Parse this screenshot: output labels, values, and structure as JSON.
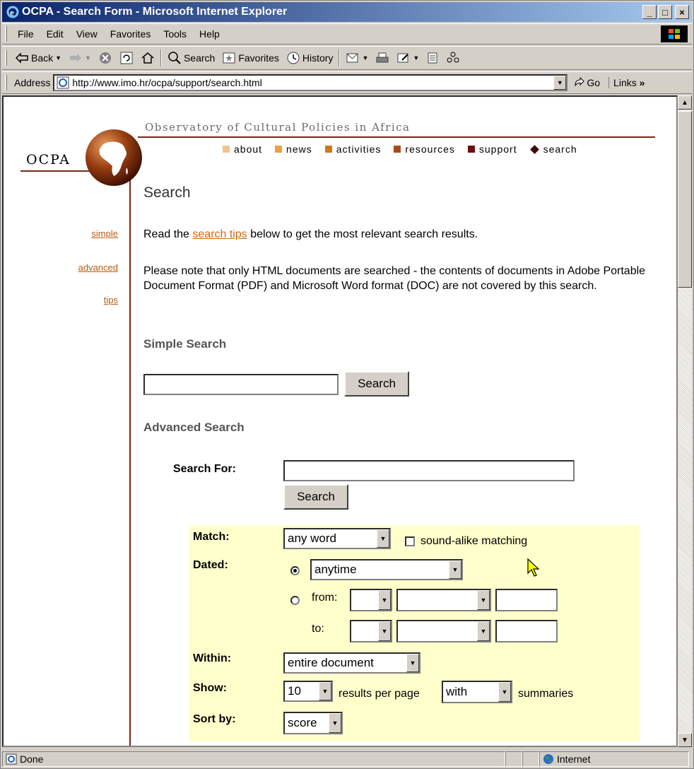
{
  "window": {
    "title": "OCPA - Search Form - Microsoft Internet Explorer",
    "min_symbol": "_",
    "max_symbol": "□",
    "close_symbol": "×"
  },
  "menu": [
    "File",
    "Edit",
    "View",
    "Favorites",
    "Tools",
    "Help"
  ],
  "toolbar": {
    "back": "Back",
    "search": "Search",
    "favorites": "Favorites",
    "history": "History"
  },
  "address": {
    "label": "Address",
    "url": "http://www.imo.hr/ocpa/support/search.html",
    "go": "Go",
    "links": "Links"
  },
  "site": {
    "tagline": "Observatory of Cultural Policies in Africa",
    "logo": "OCPA",
    "nav": [
      {
        "label": "about",
        "color": "#f5c18c"
      },
      {
        "label": "news",
        "color": "#f0a040"
      },
      {
        "label": "activities",
        "color": "#d07818"
      },
      {
        "label": "resources",
        "color": "#a84a18"
      },
      {
        "label": "support",
        "color": "#6a1010"
      },
      {
        "label": "search",
        "color": "#3a0a0a"
      }
    ],
    "side_links": [
      "simple",
      "advanced",
      "tips"
    ]
  },
  "content": {
    "heading": "Search",
    "tips_before": "Read the ",
    "tips_link": "search tips",
    "tips_after": " below to get the most relevant search results.",
    "note": "Please note that only HTML documents are searched - the contents of documents in Adobe Portable Document Format (PDF) and Microsoft Word format (DOC) are not covered by this search.",
    "simple_heading": "Simple Search",
    "simple_button": "Search",
    "advanced_heading": "Advanced Search",
    "search_for_label": "Search For:",
    "advanced_button": "Search"
  },
  "options": {
    "match_label": "Match:",
    "match_value": "any word",
    "soundalike_label": "sound-alike matching",
    "dated_label": "Dated:",
    "dated_value": "anytime",
    "from_label": "from:",
    "to_label": "to:",
    "within_label": "Within:",
    "within_value": "entire document",
    "show_label": "Show:",
    "show_value": "10",
    "results_per_page": "results per page",
    "with_value": "with",
    "summaries": "summaries",
    "sortby_label": "Sort by:",
    "sortby_value": "score"
  },
  "status": {
    "text": "Done",
    "zone": "Internet"
  }
}
